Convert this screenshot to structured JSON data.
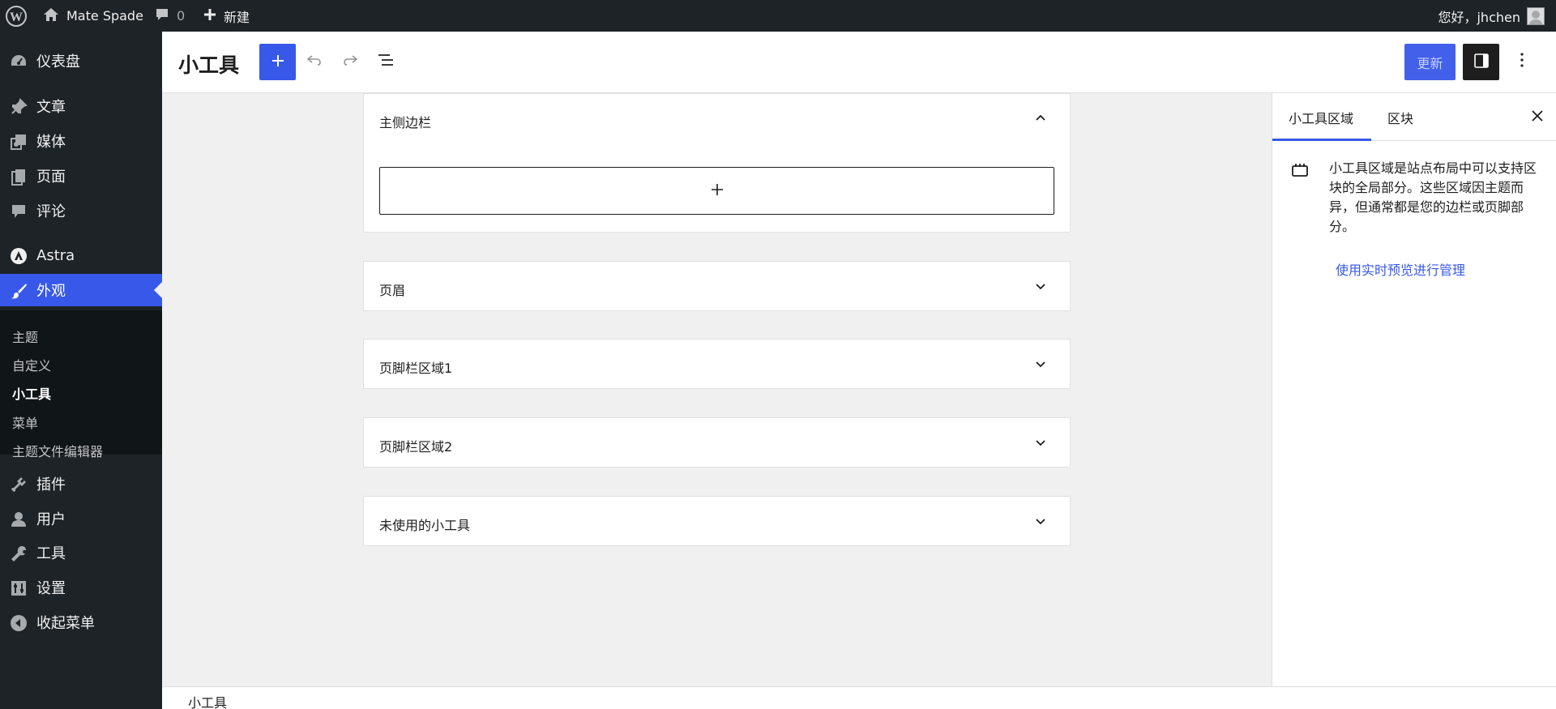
{
  "admin_bar": {
    "site_name": "Mate Spade",
    "comments_count": "0",
    "new_label": "新建",
    "greeting": "您好，jhchen"
  },
  "admin_menu": {
    "items": [
      {
        "label": "仪表盘",
        "icon": "dashboard-icon"
      },
      {
        "label": "文章",
        "icon": "pin-icon"
      },
      {
        "label": "媒体",
        "icon": "media-icon"
      },
      {
        "label": "页面",
        "icon": "page-icon"
      },
      {
        "label": "评论",
        "icon": "comment-icon"
      },
      {
        "label": "Astra",
        "icon": "astra-icon"
      },
      {
        "label": "外观",
        "icon": "brush-icon"
      },
      {
        "label": "插件",
        "icon": "plugin-icon"
      },
      {
        "label": "用户",
        "icon": "user-icon"
      },
      {
        "label": "工具",
        "icon": "wrench-icon"
      },
      {
        "label": "设置",
        "icon": "settings-icon"
      },
      {
        "label": "收起菜单",
        "icon": "collapse-icon"
      }
    ],
    "submenu": [
      "主题",
      "自定义",
      "小工具",
      "菜单",
      "主题文件编辑器"
    ]
  },
  "header": {
    "title": "小工具",
    "update_label": "更新"
  },
  "widget_areas": [
    {
      "title": "主侧边栏",
      "expanded": true
    },
    {
      "title": "页眉",
      "expanded": false
    },
    {
      "title": "页脚栏区域1",
      "expanded": false
    },
    {
      "title": "页脚栏区域2",
      "expanded": false
    },
    {
      "title": "未使用的小工具",
      "expanded": false
    }
  ],
  "sidebar": {
    "tabs": [
      "小工具区域",
      "区块"
    ],
    "active_tab": "小工具区域",
    "description": "小工具区域是站点布局中可以支持区块的全局部分。这些区域因主题而异，但通常都是您的边栏或页脚部分。",
    "link_text": "使用实时预览进行管理"
  },
  "footer": {
    "breadcrumb": "小工具"
  },
  "colors": {
    "admin_dark": "#1d2327",
    "accent": "#3858e9",
    "canvas_bg": "#f0f0f0"
  }
}
